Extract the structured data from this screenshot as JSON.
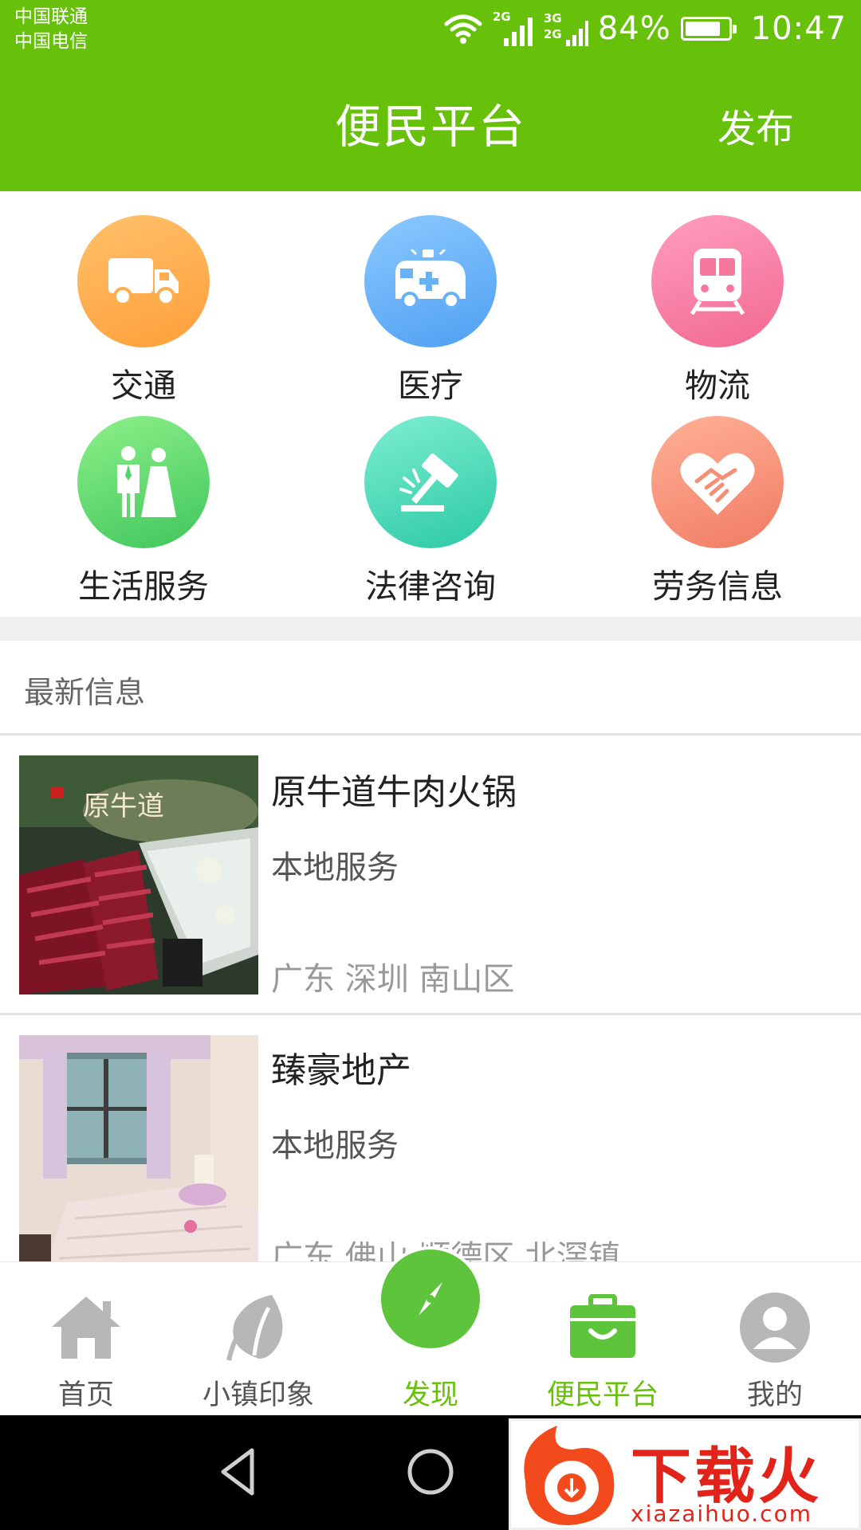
{
  "status": {
    "carrier1": "中国联通",
    "carrier2": "中国电信",
    "net1": "2G",
    "net2_top": "3G",
    "net2_bottom": "2G",
    "battery": "84%",
    "time": "10:47"
  },
  "header": {
    "title": "便民平台",
    "publish_label": "发布"
  },
  "categories": [
    {
      "label": "交通",
      "icon": "truck-icon",
      "color": "#ffae4d"
    },
    {
      "label": "医疗",
      "icon": "ambulance-icon",
      "color": "#67b2f7"
    },
    {
      "label": "物流",
      "icon": "train-icon",
      "color": "#f6789d"
    },
    {
      "label": "生活服务",
      "icon": "wedding-couple-icon",
      "color": "#55d26c"
    },
    {
      "label": "法律咨询",
      "icon": "gavel-icon",
      "color": "#41d6b3"
    },
    {
      "label": "劳务信息",
      "icon": "handshake-heart-icon",
      "color": "#f48f76"
    }
  ],
  "latest": {
    "title": "最新信息",
    "items": [
      {
        "title": "原牛道牛肉火锅",
        "category": "本地服务",
        "location": "广东 深圳 南山区",
        "sign_text": "原牛道"
      },
      {
        "title": "臻豪地产",
        "category": "本地服务",
        "location": "广东 佛山 顺德区 北滘镇"
      }
    ]
  },
  "bottom_nav": [
    {
      "label": "首页",
      "icon": "home-icon"
    },
    {
      "label": "小镇印象",
      "icon": "leaf-icon"
    },
    {
      "label": "发现",
      "icon": "compass-icon"
    },
    {
      "label": "便民平台",
      "icon": "briefcase-icon"
    },
    {
      "label": "我的",
      "icon": "user-icon"
    }
  ],
  "colors": {
    "brand": "#67c10a",
    "active_tab": "#67c10a"
  },
  "watermark": {
    "text": "下载火",
    "url": "xiazaihuo.com"
  }
}
